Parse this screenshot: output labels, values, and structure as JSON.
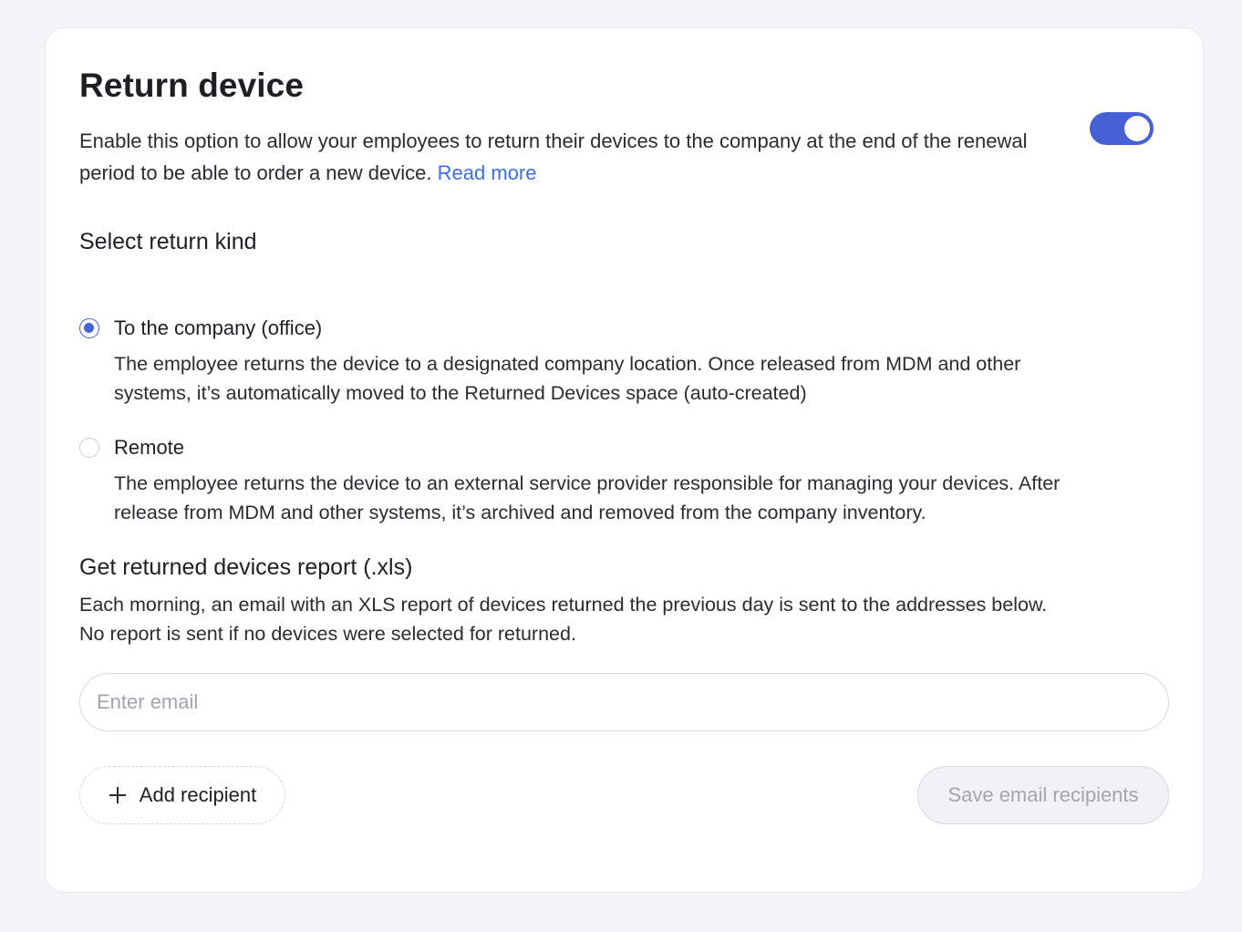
{
  "card": {
    "title": "Return device",
    "description": "Enable this option to allow your employees to return their devices to the company at the end of the renewal period to be able to order a new device.",
    "read_more": "Read more",
    "toggle_enabled": true,
    "toggle_color": "#4660d6"
  },
  "return_kind": {
    "title": "Select return kind",
    "options": [
      {
        "label": "To the company (office)",
        "description": "The employee returns the device to a designated company location. Once released from MDM and other systems, it’s automatically moved to the Returned Devices space (auto-created)",
        "selected": true
      },
      {
        "label": "Remote",
        "description": "The employee returns the device to an external service provider responsible for managing your devices. After release from MDM and other systems, it’s archived and removed from the company inventory.",
        "selected": false
      }
    ]
  },
  "report": {
    "title": "Get returned devices report (.xls)",
    "description_line1": "Each morning, an email with an XLS report of devices returned the previous day is sent to the addresses below.",
    "description_line2": "No report is sent if no devices were selected for returned.",
    "email_value": "",
    "email_placeholder": "Enter email",
    "add_recipient_label": "Add recipient",
    "save_label": "Save email recipients"
  }
}
